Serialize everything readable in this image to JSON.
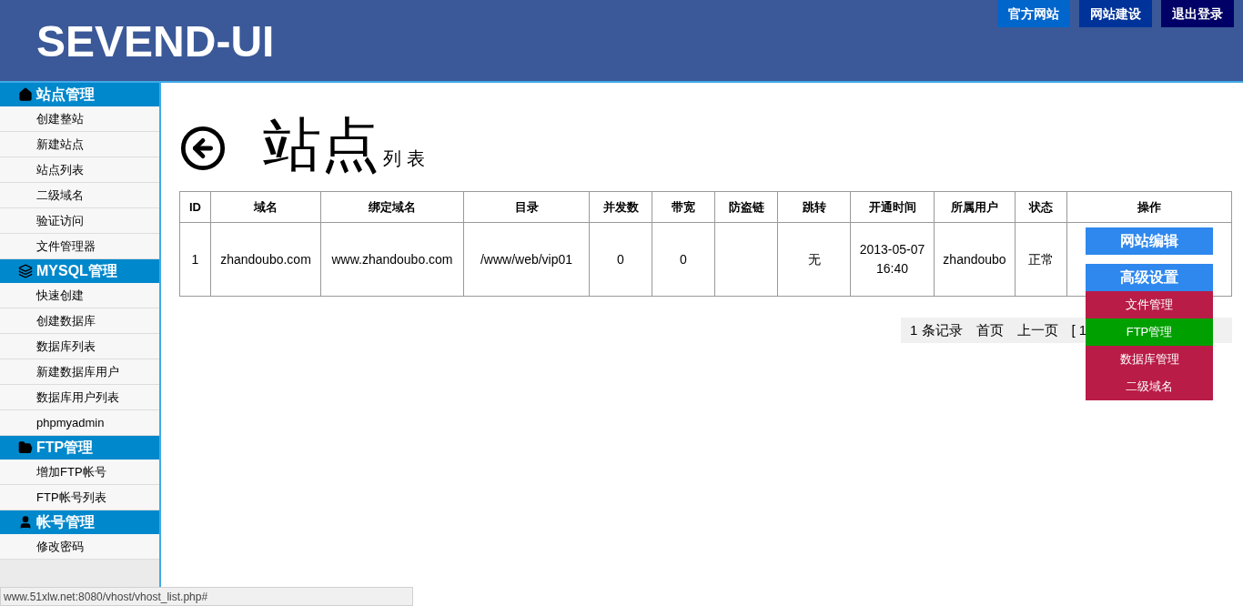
{
  "header": {
    "logo": "SEVEND-UI",
    "buttons": [
      {
        "label": "官方网站",
        "color": "#0066cc"
      },
      {
        "label": "网站建设",
        "color": "#003399"
      },
      {
        "label": "退出登录",
        "color": "#000066"
      }
    ]
  },
  "sidebar": {
    "sections": [
      {
        "title": "站点管理",
        "kind": "home",
        "items": [
          "创建整站",
          "新建站点",
          "站点列表",
          "二级域名",
          "验证访问",
          "文件管理器"
        ]
      },
      {
        "title": "MYSQL管理",
        "kind": "layers",
        "items": [
          "快速创建",
          "创建数据库",
          "数据库列表",
          "新建数据库用户",
          "数据库用户列表",
          "phpmyadmin"
        ]
      },
      {
        "title": "FTP管理",
        "kind": "folder",
        "items": [
          "增加FTP帐号",
          "FTP帐号列表"
        ]
      },
      {
        "title": "帐号管理",
        "kind": "user",
        "items": [
          "修改密码"
        ]
      }
    ]
  },
  "page": {
    "title": "站点",
    "subtitle": "列 表"
  },
  "table": {
    "columns": [
      "ID",
      "域名",
      "绑定域名",
      "目录",
      "并发数",
      "带宽",
      "防盗链",
      "跳转",
      "开通时间",
      "所属用户",
      "状态",
      "操作"
    ],
    "rows": [
      {
        "cells": [
          "1",
          "zhandoubo.com",
          "www.zhandoubo.com",
          "/www/web/vip01",
          "0",
          "0",
          "",
          "无",
          "2013-05-07 16:40",
          "zhandoubo",
          "正常"
        ],
        "actions": [
          "网站编辑",
          "高级设置"
        ]
      }
    ]
  },
  "menu": {
    "items": [
      {
        "label": "文件管理",
        "color": "#b91c47"
      },
      {
        "label": "FTP管理",
        "color": "#00a000"
      },
      {
        "label": "数据库管理",
        "color": "#b91c47"
      },
      {
        "label": "二级域名",
        "color": "#b91c47"
      }
    ]
  },
  "pagination": [
    "1 条记录",
    "首页",
    "上一页",
    "[ 1"
  ],
  "status_bar": "www.51xlw.net:8080/vhost/vhost_list.php#"
}
